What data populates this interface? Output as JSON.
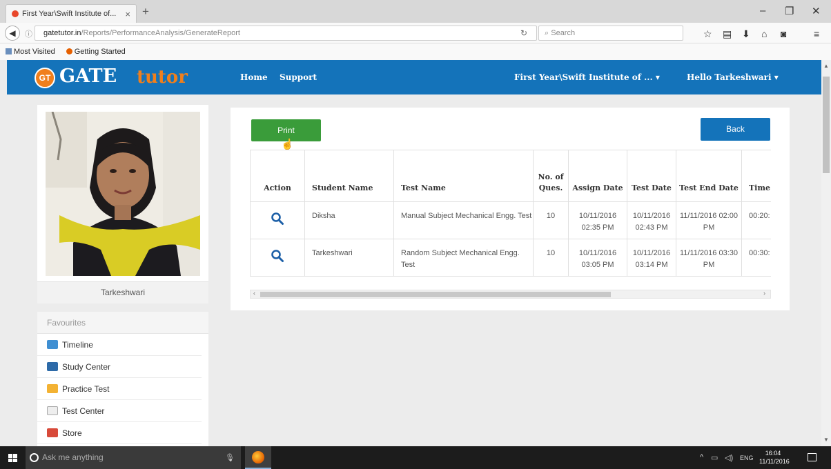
{
  "browser": {
    "tab_title": "First Year\\Swift Institute of...",
    "url_host": "gatetutor.in",
    "url_path": "/Reports/PerformanceAnalysis/GenerateReport",
    "search_placeholder": "Search",
    "bookmarks": [
      "Most Visited",
      "Getting Started"
    ]
  },
  "header": {
    "logo_badge": "GT",
    "logo_gate": "GATE",
    "logo_tutor": "tutor",
    "nav": [
      "Home",
      "Support"
    ],
    "institute_menu": "First Year\\Swift Institute of ... ▾",
    "user_menu": "Hello Tarkeshwari ▾"
  },
  "profile": {
    "name": "Tarkeshwari"
  },
  "favourites": {
    "title": "Favourites",
    "items": [
      "Timeline",
      "Study Center",
      "Practice Test",
      "Test Center",
      "Store"
    ]
  },
  "report": {
    "print_label": "Print",
    "back_label": "Back",
    "columns": [
      "Action",
      "Student Name",
      "Test Name",
      "No. of Ques.",
      "Assign Date",
      "Test Date",
      "Test End Date",
      "Time"
    ],
    "rows": [
      {
        "student": "Diksha",
        "test": "Manual Subject Mechanical Engg. Test",
        "questions": "10",
        "assign_date": "10/11/2016 02:35 PM",
        "test_date": "10/11/2016 02:43 PM",
        "end_date": "11/11/2016 02:00 PM",
        "time": "00:20:"
      },
      {
        "student": "Tarkeshwari",
        "test": "Random Subject Mechanical Engg. Test",
        "questions": "10",
        "assign_date": "10/11/2016 03:05 PM",
        "test_date": "10/11/2016 03:14 PM",
        "end_date": "11/11/2016 03:30 PM",
        "time": "00:30:"
      }
    ]
  },
  "taskbar": {
    "search_placeholder": "Ask me anything",
    "lang": "ENG",
    "time": "16:04",
    "date": "11/11/2016"
  },
  "colors": {
    "header_blue": "#1473ba",
    "logo_orange": "#f07f1c",
    "print_green": "#3a9c3a"
  }
}
